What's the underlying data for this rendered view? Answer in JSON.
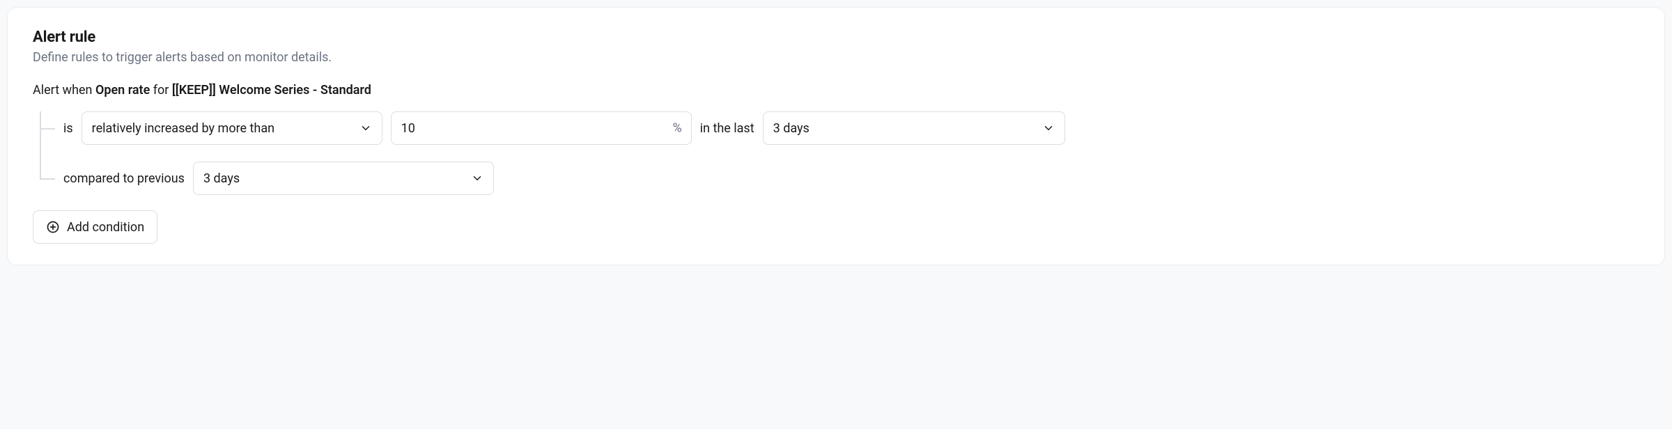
{
  "header": {
    "title": "Alert rule",
    "subtitle": "Define rules to trigger alerts based on monitor details."
  },
  "sentence": {
    "prefix": "Alert when ",
    "metric": "Open rate",
    "mid": " for ",
    "target": "[[KEEP]] Welcome Series - Standard"
  },
  "condition": {
    "is_label": "is",
    "comparison_value": "relatively increased by more than",
    "threshold_value": "10",
    "threshold_suffix": "%",
    "in_the_last_label": "in the last",
    "last_window_value": "3 days",
    "compared_to_label": "compared to previous",
    "previous_window_value": "3 days"
  },
  "actions": {
    "add_condition_label": "Add condition"
  }
}
